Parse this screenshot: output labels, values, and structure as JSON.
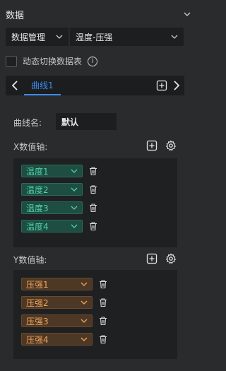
{
  "section": {
    "title": "数据"
  },
  "dropdowns": {
    "source": "数据管理",
    "table": "温度-压强"
  },
  "dynamic_switch": {
    "label": "动态切换数据表",
    "info_icon": "i"
  },
  "tabs": [
    {
      "label": "曲线1"
    }
  ],
  "curve": {
    "name_label": "曲线名:",
    "name_value": "默认"
  },
  "x_axis": {
    "label": "X数值轴:",
    "fields": [
      "温度1",
      "温度2",
      "温度3",
      "温度4"
    ],
    "color": "#4fd1a8"
  },
  "y_axis": {
    "label": "Y数值轴:",
    "fields": [
      "压强1",
      "压强2",
      "压强3",
      "压强4"
    ],
    "color": "#f0a65a"
  }
}
